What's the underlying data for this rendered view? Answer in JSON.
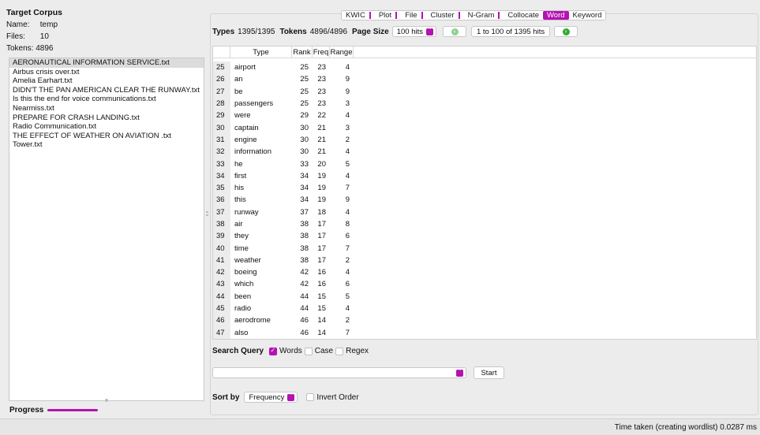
{
  "corpus": {
    "title": "Target Corpus",
    "name_label": "Name:",
    "name_value": "temp",
    "files_label": "Files:",
    "files_value": "10",
    "tokens_label": "Tokens:",
    "tokens_value": "4896",
    "files": [
      "AERONAUTICAL INFORMATION SERVICE.txt",
      "Airbus crisis over.txt",
      "Amelia Earhart.txt",
      "DIDN'T THE PAN AMERICAN CLEAR THE RUNWAY.txt",
      "Is this the end for voice communications.txt",
      "Nearmiss.txt",
      "PREPARE FOR CRASH LANDING.txt",
      "Radio Communication.txt",
      "THE EFFECT OF WEATHER ON AVIATION .txt",
      "Tower.txt"
    ],
    "progress_label": "Progress"
  },
  "tabs": [
    "KWIC",
    "Plot",
    "File",
    "Cluster",
    "N-Gram",
    "Collocate",
    "Word",
    "Keyword"
  ],
  "active_tab": "Word",
  "toolbar": {
    "types_label": "Types",
    "types_value": "1395/1395",
    "tokens_label": "Tokens",
    "tokens_value": "4896/4896",
    "page_size_label": "Page Size",
    "page_size_value": "100 hits",
    "hits_range": "1 to 100 of 1395 hits"
  },
  "table": {
    "headers": [
      "",
      "Type",
      "Rank",
      "Freq",
      "Range"
    ],
    "rows": [
      [
        "25",
        "airport",
        "25",
        "23",
        "4"
      ],
      [
        "26",
        "an",
        "25",
        "23",
        "9"
      ],
      [
        "27",
        "be",
        "25",
        "23",
        "9"
      ],
      [
        "28",
        "passengers",
        "25",
        "23",
        "3"
      ],
      [
        "29",
        "were",
        "29",
        "22",
        "4"
      ],
      [
        "30",
        "captain",
        "30",
        "21",
        "3"
      ],
      [
        "31",
        "engine",
        "30",
        "21",
        "2"
      ],
      [
        "32",
        "information",
        "30",
        "21",
        "4"
      ],
      [
        "33",
        "he",
        "33",
        "20",
        "5"
      ],
      [
        "34",
        "first",
        "34",
        "19",
        "4"
      ],
      [
        "35",
        "his",
        "34",
        "19",
        "7"
      ],
      [
        "36",
        "this",
        "34",
        "19",
        "9"
      ],
      [
        "37",
        "runway",
        "37",
        "18",
        "4"
      ],
      [
        "38",
        "air",
        "38",
        "17",
        "8"
      ],
      [
        "39",
        "they",
        "38",
        "17",
        "6"
      ],
      [
        "40",
        "time",
        "38",
        "17",
        "7"
      ],
      [
        "41",
        "weather",
        "38",
        "17",
        "2"
      ],
      [
        "42",
        "boeing",
        "42",
        "16",
        "4"
      ],
      [
        "43",
        "which",
        "42",
        "16",
        "6"
      ],
      [
        "44",
        "been",
        "44",
        "15",
        "5"
      ],
      [
        "45",
        "radio",
        "44",
        "15",
        "4"
      ],
      [
        "46",
        "aerodrome",
        "46",
        "14",
        "2"
      ],
      [
        "47",
        "also",
        "46",
        "14",
        "7"
      ]
    ]
  },
  "search": {
    "label": "Search Query",
    "words_label": "Words",
    "words_checked": true,
    "case_label": "Case",
    "case_checked": false,
    "regex_label": "Regex",
    "regex_checked": false,
    "query_value": "",
    "start_label": "Start"
  },
  "sort": {
    "label": "Sort by",
    "value": "Frequency",
    "invert_label": "Invert Order",
    "invert_checked": false
  },
  "status_text": "Time taken (creating wordlist) 0.0287 ms",
  "colors": {
    "accent": "#b512b3",
    "nav_green": "#2eaa2e"
  }
}
